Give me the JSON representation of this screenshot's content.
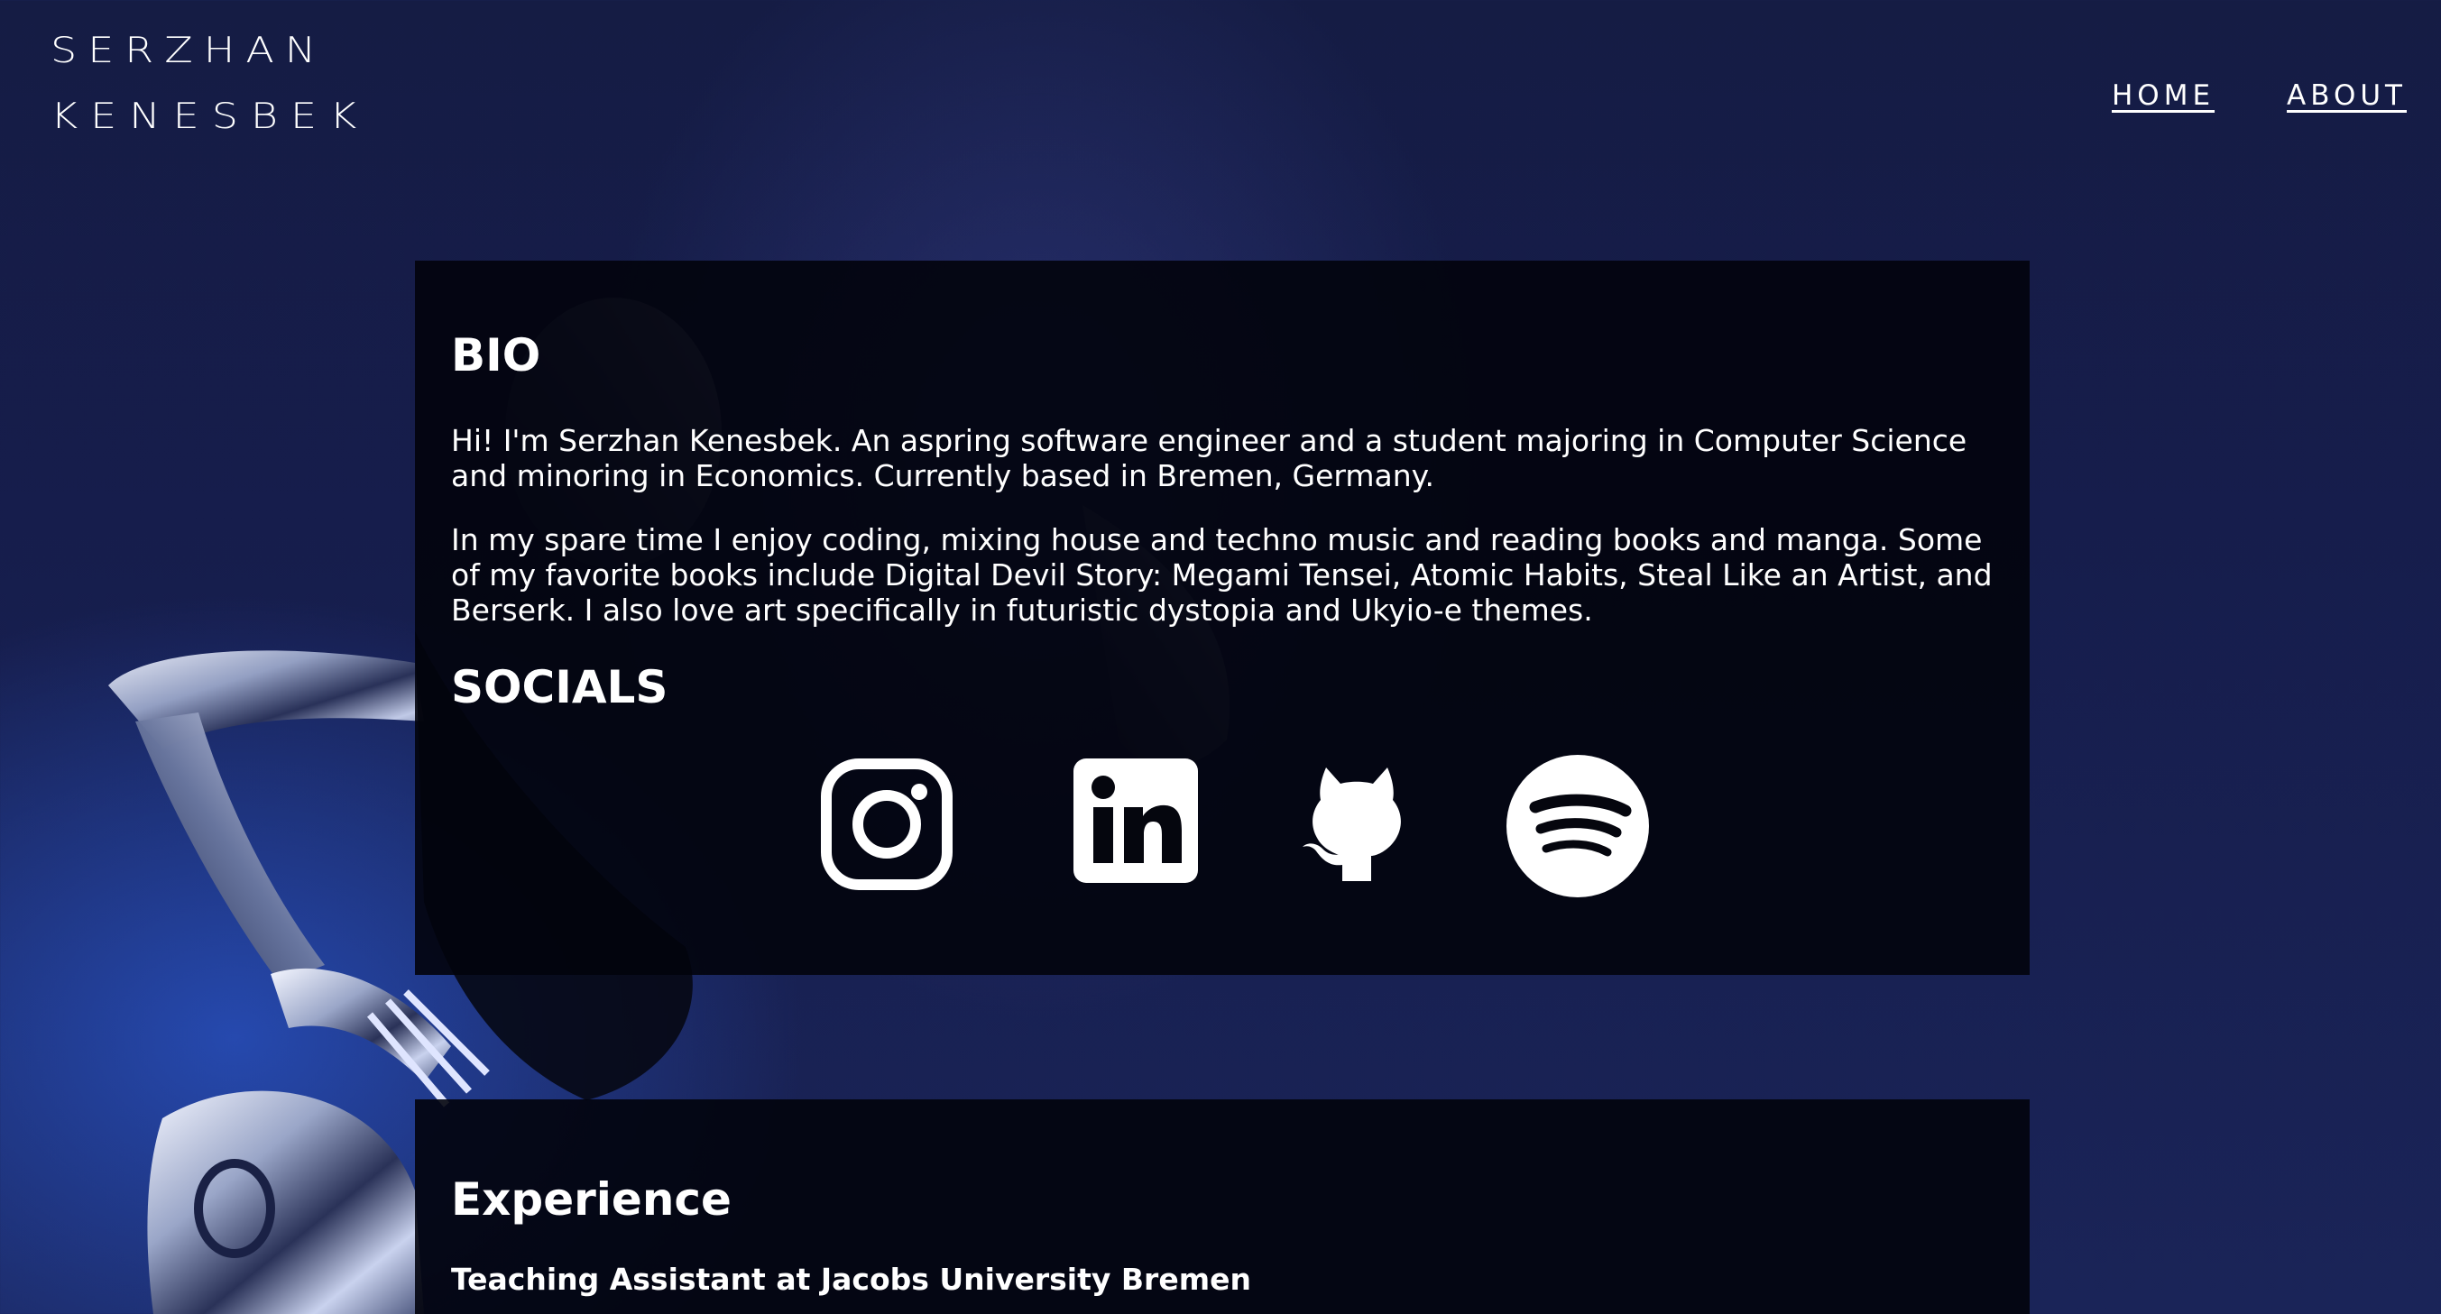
{
  "header": {
    "logo_line1": "SERZHAN",
    "logo_line2": "KENESBEK",
    "nav": [
      {
        "label": "HOME"
      },
      {
        "label": "ABOUT"
      }
    ]
  },
  "bio": {
    "title": "BIO",
    "paragraph1": "Hi! I'm Serzhan Kenesbek. An aspring software engineer and a student majoring in Computer Science and minoring in Economics. Currently based in Bremen, Germany.",
    "paragraph2": "In my spare time I enjoy coding, mixing house and techno music and reading books and manga. Some of my favorite books include Digital Devil Story: Megami Tensei, Atomic Habits, Steal Like an Artist, and Berserk. I also love art specifically in futuristic dystopia and Ukyio-e themes."
  },
  "socials": {
    "title": "SOCIALS",
    "links": [
      {
        "icon": "instagram-icon"
      },
      {
        "icon": "linkedin-icon"
      },
      {
        "icon": "github-icon"
      },
      {
        "icon": "spotify-icon"
      }
    ]
  },
  "experience": {
    "title": "Experience",
    "role": "Teaching Assistant at Jacobs University Bremen"
  },
  "colors": {
    "background": "#161d4c",
    "panel": "#02030c",
    "text": "#ffffff"
  }
}
